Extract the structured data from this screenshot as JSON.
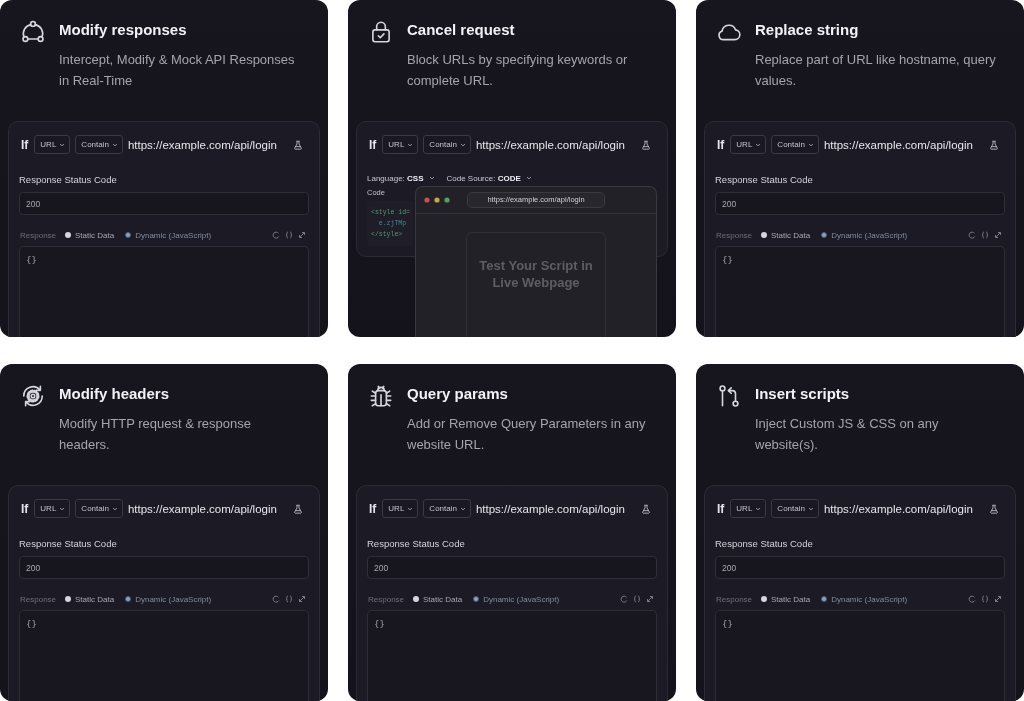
{
  "cards": [
    {
      "title": "Modify responses",
      "description": "Intercept, Modify & Mock API Responses in Real-Time",
      "preview": {
        "kind": "response",
        "condition": {
          "keyword": "If",
          "field": "URL",
          "operator": "Contain",
          "url": "https://example.com/api/login"
        },
        "status_label": "Response Status Code",
        "status_value": "200",
        "response_label": "Response",
        "options": [
          {
            "label": "Static Data",
            "selected": true
          },
          {
            "label": "Dynamic (JavaScript)",
            "selected": false
          }
        ],
        "body": "{}"
      }
    },
    {
      "title": "Cancel request",
      "description": "Block URLs by specifying keywords or complete URL.",
      "preview": {
        "kind": "script",
        "condition": {
          "keyword": "If",
          "field": "URL",
          "operator": "Contain",
          "url": "https://example.com/api/login"
        },
        "language": "Language: **CSS**",
        "source": "Code Source: **CODE**",
        "code_label": "Code",
        "code_lines": [
          "<style id=",
          "  e.zjTMp",
          "</style>"
        ],
        "browser": {
          "url": "https://example.com/api/login",
          "message": "Test Your Script in Live Webpage"
        }
      }
    },
    {
      "title": "Replace string",
      "description": "Replace part of URL like hostname, query values.",
      "preview": {
        "kind": "response",
        "condition": {
          "keyword": "If",
          "field": "URL",
          "operator": "Contain",
          "url": "https://example.com/api/login"
        },
        "status_label": "Response Status Code",
        "status_value": "200",
        "response_label": "Response",
        "options": [
          {
            "label": "Static Data",
            "selected": true
          },
          {
            "label": "Dynamic (JavaScript)",
            "selected": false
          }
        ],
        "body": "{}"
      }
    },
    {
      "title": "Modify headers",
      "description": "Modify HTTP request & response headers.",
      "preview": {
        "kind": "response",
        "condition": {
          "keyword": "If",
          "field": "URL",
          "operator": "Contain",
          "url": "https://example.com/api/login"
        },
        "status_label": "Response Status Code",
        "status_value": "200",
        "response_label": "Response",
        "options": [
          {
            "label": "Static Data",
            "selected": true
          },
          {
            "label": "Dynamic (JavaScript)",
            "selected": false
          }
        ],
        "body": "{}"
      }
    },
    {
      "title": "Query params",
      "description": "Add or Remove Query Parameters in any website URL.",
      "preview": {
        "kind": "response",
        "condition": {
          "keyword": "If",
          "field": "URL",
          "operator": "Contain",
          "url": "https://example.com/api/login"
        },
        "status_label": "Response Status Code",
        "status_value": "200",
        "response_label": "Response",
        "options": [
          {
            "label": "Static Data",
            "selected": true
          },
          {
            "label": "Dynamic (JavaScript)",
            "selected": false
          }
        ],
        "body": "{}"
      }
    },
    {
      "title": "Insert scripts",
      "description": "Inject Custom JS & CSS on any website(s).",
      "preview": {
        "kind": "response",
        "condition": {
          "keyword": "If",
          "field": "URL",
          "operator": "Contain",
          "url": "https://example.com/api/login"
        },
        "status_label": "Response Status Code",
        "status_value": "200",
        "response_label": "Response",
        "options": [
          {
            "label": "Static Data",
            "selected": true
          },
          {
            "label": "Dynamic (JavaScript)",
            "selected": false
          }
        ],
        "body": "{}"
      }
    }
  ]
}
